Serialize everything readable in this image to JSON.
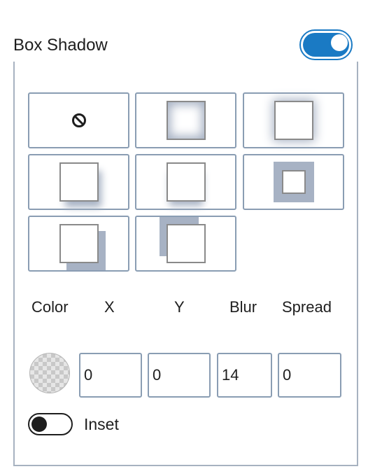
{
  "panel": {
    "title": "Box Shadow",
    "enabled": true
  },
  "presets": [
    {
      "name": "none",
      "icon": "prohibited-icon"
    },
    {
      "name": "inner glow"
    },
    {
      "name": "outer glow"
    },
    {
      "name": "bottom-right soft"
    },
    {
      "name": "bottom soft"
    },
    {
      "name": "solid border spread"
    },
    {
      "name": "solid offset bottom-right"
    },
    {
      "name": "solid offset top-left"
    }
  ],
  "labels": {
    "color": "Color",
    "x": "X",
    "y": "Y",
    "blur": "Blur",
    "spread": "Spread"
  },
  "values": {
    "color": "transparent",
    "x": "0",
    "y": "0",
    "blur": "14",
    "spread": "0"
  },
  "inset": {
    "label": "Inset",
    "enabled": false
  },
  "colors": {
    "accent": "#1a7ac4",
    "border": "#8a9db3",
    "shadow": "#a7b2c4"
  }
}
